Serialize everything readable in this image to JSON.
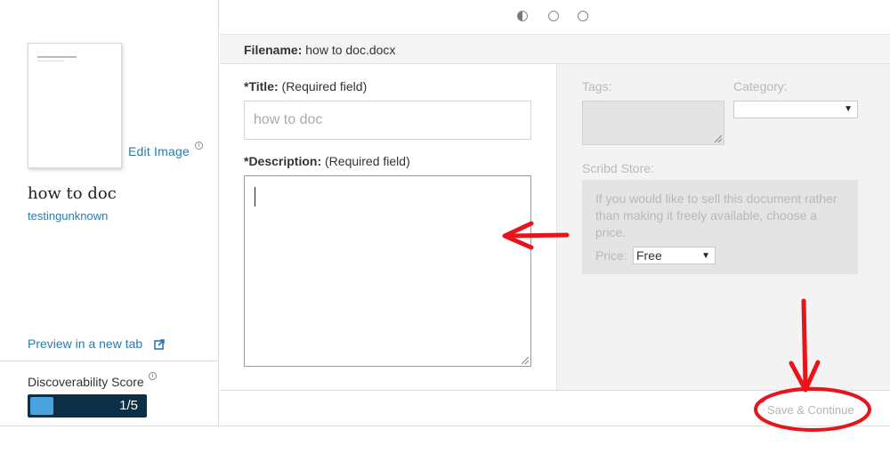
{
  "sidebar": {
    "edit_image_label": "Edit Image",
    "doc_title": "how to doc",
    "username": "testingunknown",
    "preview_label": "Preview in a new tab",
    "discoverability_label": "Discoverability Score",
    "score_text": "1/5",
    "score_fraction": 0.2
  },
  "steps": {
    "count": 3,
    "current": 1
  },
  "filename": {
    "label": "Filename:",
    "value": "how to doc.docx"
  },
  "form": {
    "title_label": "*Title:",
    "title_hint": "(Required field)",
    "title_value": "how to doc",
    "description_label": "*Description:",
    "description_hint": "(Required field)",
    "description_value": "",
    "tags_label": "Tags:",
    "category_label": "Category:",
    "store_label": "Scribd Store:",
    "store_text": "If you would like to sell this document rather than making it freely available, choose a price.",
    "price_label": "Price:",
    "price_value": "Free"
  },
  "footer": {
    "save_label": "Save & Continue"
  },
  "colors": {
    "link": "#2b7ca8",
    "score_bar": "#0d2e47",
    "score_fill": "#4aa3df",
    "annotation": "#e8141b"
  },
  "icons": {
    "edit_info": "info-icon",
    "external": "external-link-icon",
    "discoverability_info": "info-icon"
  }
}
